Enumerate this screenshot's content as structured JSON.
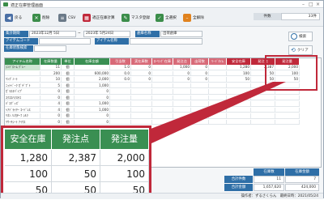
{
  "window": {
    "title": "適正在庫管理画面"
  },
  "toolbar": {
    "buttons": [
      {
        "label": "戻る",
        "color": "#4a6fa5"
      },
      {
        "label": "削除",
        "color": "#3b8d4a"
      },
      {
        "label": "CSV",
        "color": "#6b7a88"
      },
      {
        "label": "適正在庫計算",
        "color": "#c0283a"
      },
      {
        "label": "マスタ登録",
        "color": "#3b8d4a"
      },
      {
        "label": "全選択",
        "color": "#3b8d4a"
      },
      {
        "label": "全解除",
        "color": "#e0821e"
      }
    ],
    "count_label": "件数",
    "count_value": "33件"
  },
  "filters": {
    "period_label": "集計期間",
    "period_from": "2023年12月 5日",
    "period_to": "2023年 5月24日",
    "warehouse_label": "倉庫名称",
    "warehouse_value": "出荷倉庫",
    "item_code_label": "アイテムコード",
    "item_name_label": "アイテム名称",
    "extra_label": "在庫状態検索",
    "search_button": "検索",
    "clear_button": "クリア"
  },
  "grid": {
    "header_color": "#3a8f52",
    "headers": [
      "アイテム名称",
      "在庫数量",
      "単位",
      "在庫金額",
      "引当数",
      "実在庫数",
      "ﾛｰﾘﾝｸﾞ在庫",
      "発注点",
      "出荷数",
      "ﾘｰﾄﾞﾀｲﾑ",
      "安全在庫",
      "発注点",
      "発注量"
    ],
    "rows": [
      [
        "ｼﾝﾄﾞﾛｰﾑ ｸﾞﾚｰ",
        "11",
        "個",
        "",
        "1.0",
        "0",
        "",
        "1,000",
        "0",
        "",
        "1,280",
        "2,387",
        "2,000"
      ],
      [
        "",
        "200",
        "個",
        "600,000",
        "0.0",
        "0",
        "",
        "0",
        "0",
        "",
        "100",
        "50",
        "100"
      ],
      [
        "ﾘﾝｸﾞﾉｰﾄ",
        "10",
        "個",
        "2,000",
        "0.0",
        "0",
        "",
        "0",
        "0",
        "",
        "50",
        "50",
        "50"
      ],
      [
        "ﾆｯﾄﾍﾞｰｸ ｶﾞﾃﾞﾌﾞﾄ",
        "5",
        "個",
        "1,000",
        "",
        "",
        "",
        "",
        "",
        "",
        "",
        "",
        ""
      ],
      [
        "ｶﾞﾗｽｷﾊﾟｲﾌﾟ",
        "0",
        "個",
        "0",
        "",
        "",
        "",
        "",
        "",
        "",
        "",
        "",
        ""
      ],
      [
        "ｽｸｽｽﾊｸｽﾃｽ",
        "0",
        "個",
        "0",
        "",
        "",
        "",
        "",
        "",
        "",
        "",
        "",
        ""
      ],
      [
        "ﾊﾞｽｸﾞｯｽﾞ",
        "4",
        "個",
        "1,000",
        "",
        "",
        "",
        "",
        "",
        "",
        "",
        "",
        ""
      ],
      [
        "ﾍｱﾄﾞﾗｲﾔｰ ｺｰﾄﾞﾚｽ",
        "4",
        "個",
        "1,000",
        "",
        "",
        "",
        "",
        "",
        "",
        "",
        "",
        ""
      ],
      [
        "ﾘﾈﾝ ﾊﾝｶﾁｰﾌ ｼﾙｸ",
        "0",
        "個",
        "0",
        "",
        "",
        "",
        "",
        "",
        "",
        "",
        "",
        ""
      ],
      [
        "ﾘｻｰﾁｼｰﾄ ｱｲﾏｽ",
        "0",
        "個",
        "0",
        "",
        "",
        "",
        "",
        "",
        "",
        "",
        "",
        ""
      ]
    ]
  },
  "zoom": {
    "headers": [
      "安全在庫",
      "発注点",
      "発注量"
    ],
    "rows": [
      [
        "1,280",
        "2,387",
        "2,000"
      ],
      [
        "100",
        "50",
        "100"
      ],
      [
        "50",
        "50",
        "50"
      ]
    ]
  },
  "footer": {
    "col_labels": [
      "在庫数",
      "在庫金額"
    ],
    "row1_label": "合計件数",
    "row1_values": [
      "11",
      "7"
    ],
    "row2_label": "合計金額",
    "row2_values": [
      "1,657,620",
      "424,000"
    ]
  },
  "status": {
    "text": "操作者：ずるさくらん　最終日時：2021/05/24"
  }
}
